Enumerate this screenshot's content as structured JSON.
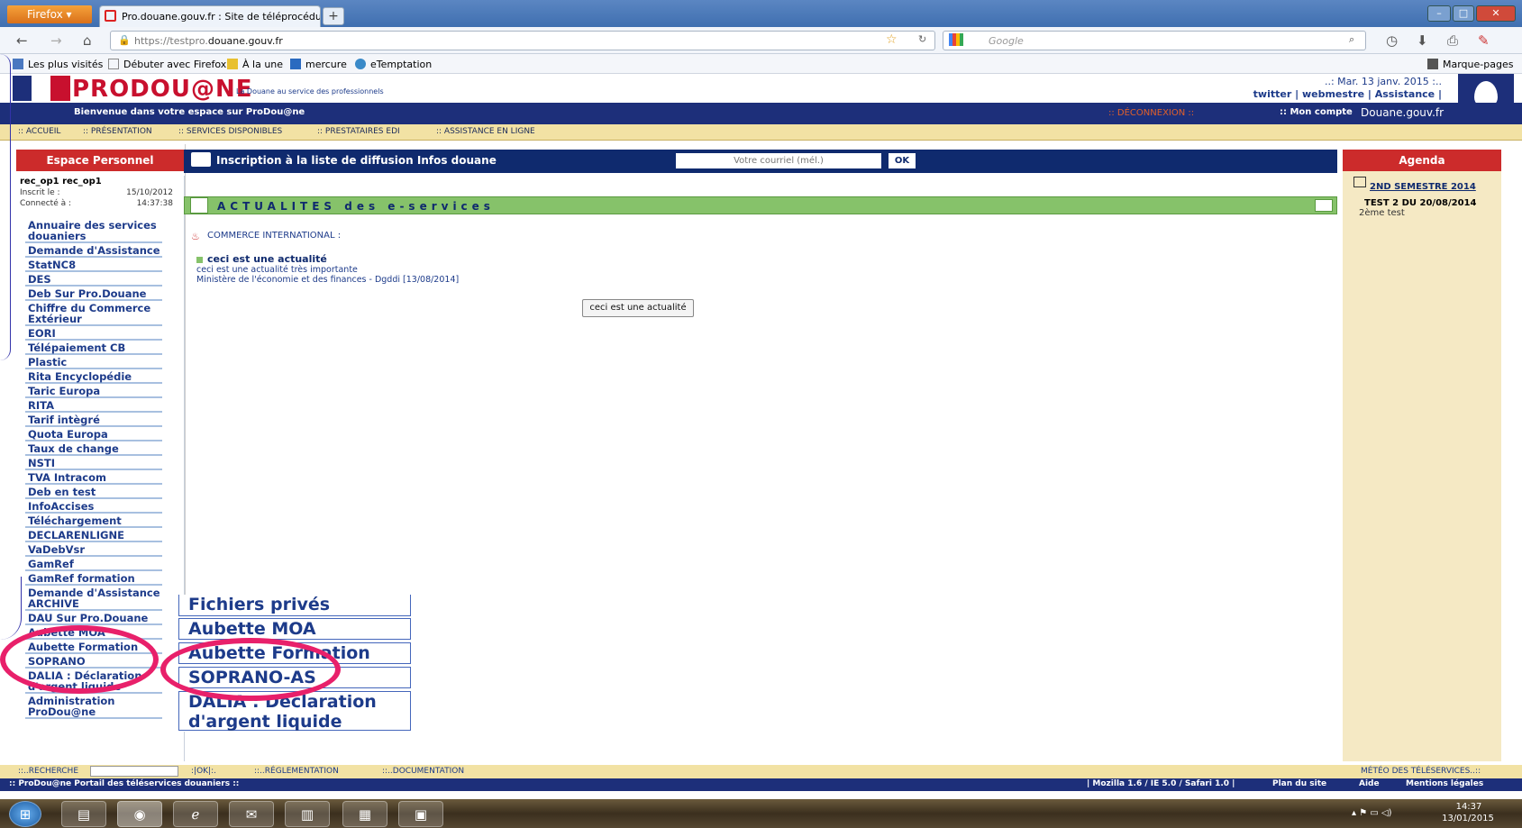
{
  "browser": {
    "app_button": "Firefox ▾",
    "tab_title": "Pro.douane.gouv.fr : Site de téléprocédu...",
    "new_tab": "+",
    "url_prefix": "https://testpro.",
    "url_domain": "douane.gouv.fr",
    "search_placeholder": "Google",
    "bookmarks": [
      "Les plus visités",
      "Débuter avec Firefox",
      "À la une",
      "mercure",
      "eTemptation"
    ],
    "bookmarks_right": "Marque-pages"
  },
  "header": {
    "logo": "PRODOU@NE",
    "tagline": "La Douane au service des professionnels",
    "date": "..: Mar. 13 janv. 2015 :..",
    "links": "twitter | webmestre | Assistance |",
    "welcome": "Bienvenue dans votre espace sur ProDou@ne",
    "logout": ":: DÉCONNEXION ::",
    "account": ":: Mon compte",
    "site": "Douane.gouv.fr",
    "nav": [
      ":: ACCUEIL",
      ":: PRÉSENTATION",
      ":: SERVICES DISPONIBLES",
      ":: PRESTATAIRES EDI",
      ":: ASSISTANCE EN LIGNE"
    ]
  },
  "left": {
    "title": "Espace Personnel",
    "user_name": "rec_op1 rec_op1",
    "inscrit_label": "Inscrit le  :",
    "inscrit_value": "15/10/2012",
    "connecte_label": "Connecté à :",
    "connecte_value": "14:37:38",
    "menu": [
      "Annuaire des services douaniers",
      "Demande d'Assistance",
      "StatNC8",
      "DES",
      "Deb Sur Pro.Douane",
      "Chiffre du Commerce Extérieur",
      "EORI",
      "Télépaiement CB",
      "Plastic",
      "Rita Encyclopédie",
      "Taric Europa",
      "RITA",
      "Tarif intègré",
      "Quota Europa",
      "Taux de change",
      "NSTI",
      "TVA Intracom",
      "Deb en test",
      "InfoAccises",
      "Téléchargement",
      "DECLARENLIGNE",
      "VaDebVsr",
      "GamRef",
      "GamRef formation",
      "Demande d'Assistance ARCHIVE",
      "DAU Sur Pro.Douane",
      "Aubette MOA",
      "Aubette Formation",
      "SOPRANO",
      "DALIA : Déclaration d'argent liquide",
      "Administration ProDou@ne"
    ]
  },
  "main": {
    "inscription_label": "Inscription à la liste de diffusion Infos douane",
    "email_placeholder": "Votre courriel (mél.)",
    "ok": "OK",
    "actu_title": "ACTUALITES des e-services",
    "category": "COMMERCE INTERNATIONAL :",
    "news_title": "ceci est une actualité",
    "news_desc": "ceci est une actualité très importante",
    "news_source": "Ministère de l'économie et des finances - Dgddi [13/08/2014]",
    "news_button": "ceci est une actualité"
  },
  "zoom": {
    "items": [
      "Fichiers privés",
      "Aubette MOA",
      "Aubette Formation",
      "SOPRANO-AS",
      "DALIA : Déclaration d'argent liquide"
    ]
  },
  "agenda": {
    "title": "Agenda",
    "period": "2ND SEMESTRE 2014",
    "event_title": "TEST 2 DU 20/08/2014",
    "event_desc": "2ème test"
  },
  "footer": {
    "search_label": "::..RECHERCHE",
    "ok": ":|OK|:.",
    "reglementation": "::..RÉGLEMENTATION",
    "documentation": "::..DOCUMENTATION",
    "meteo": "MÉTÉO DES TÉLÉSERVICES..::",
    "portal": ":: ProDou@ne Portail des téléservices douaniers ::",
    "browsers": "| Mozilla 1.6 / IE 5.0 / Safari 1.0 |",
    "plan": "Plan du site",
    "aide": "Aide",
    "mentions": "Mentions légales"
  },
  "taskbar": {
    "time": "14:37",
    "date": "13/01/2015"
  },
  "colors": {
    "brand_red": "#cc2b2b",
    "brand_blue": "#1d2f7a",
    "highlight": "#e8206a",
    "actu_green": "#86c26a"
  }
}
